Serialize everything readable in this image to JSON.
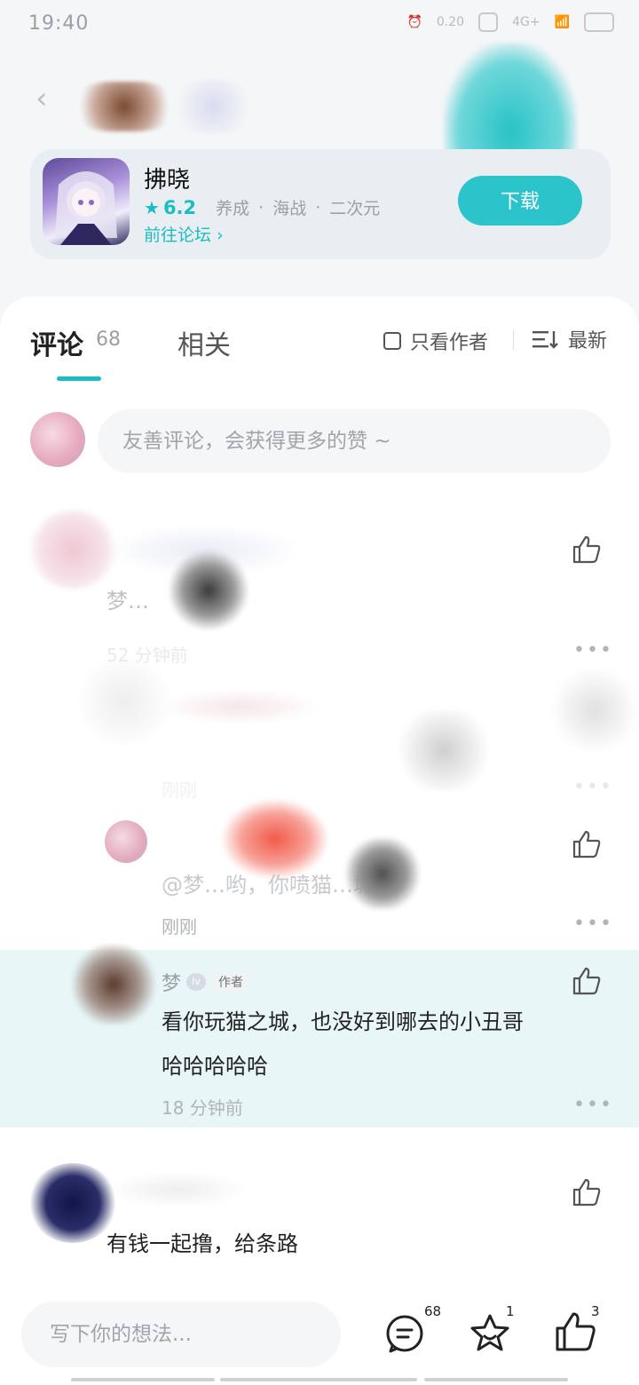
{
  "status_bar": {
    "time": "19:40",
    "net_speed": "0.20",
    "signal": "4G+"
  },
  "app": {
    "name": "拂晓",
    "rating": "6.2",
    "tags": [
      "养成",
      "海战",
      "二次元"
    ],
    "forum_link": "前往论坛",
    "download_label": "下载"
  },
  "tabs": {
    "comments_label": "评论",
    "comments_count": "68",
    "related_label": "相关",
    "author_only_label": "只看作者",
    "sort_label": "最新"
  },
  "composer": {
    "placeholder": "友善评论，会获得更多的赞 ~"
  },
  "comments": [
    {
      "text": "梦…",
      "time": "52 分钟前"
    },
    {
      "time": "刚刚"
    },
    {
      "reply_prefix": "@梦…",
      "text": "@梦…哟，你喷猫…城?",
      "time": "刚刚"
    },
    {
      "name": "梦",
      "badge": "作者",
      "text_line1": "看你玩猫之城，也没好到哪去的小丑哥",
      "text_line2": "哈哈哈哈哈",
      "time": "18 分钟前"
    },
    {
      "text": "有钱一起撸，给条路"
    }
  ],
  "bottom": {
    "placeholder": "写下你的想法...",
    "comment_count": "68",
    "favorite_count": "1",
    "like_count": "3"
  },
  "colors": {
    "accent": "#1bbcc3",
    "highlight_bg": "#e8f6f8"
  }
}
